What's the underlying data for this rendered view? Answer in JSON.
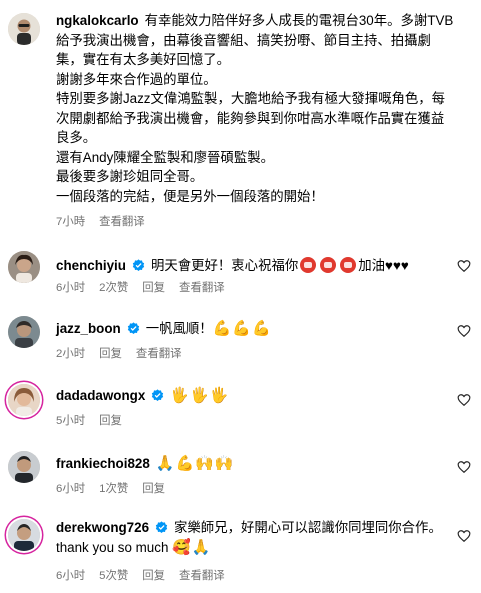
{
  "comments": [
    {
      "username": "ngkalokcarlo",
      "verified": false,
      "text": "有幸能效力陪伴好多人成長的電視台30年。多謝TVB給予我演出機會，由幕後音響組、搞笑扮嘢、節目主持、拍攝劇集，實在有太多美好回憶了。\n謝謝多年來合作過的單位。\n特別要多謝Jazz文偉鴻監製，大膽地給予我有極大發揮嘅角色，每次開劇都給予我演出機會，能夠參與到你咁高水準嘅作品實在獲益良多。\n還有Andy陳耀全監製和廖晉碩監製。\n最後要多謝珍姐同全哥。\n一個段落的完結，便是另外一個段落的開始！",
      "time": "7小時",
      "likes": "",
      "reply": "",
      "translate": "查看翻译",
      "has_heart": false
    },
    {
      "username": "chenchiyiu",
      "verified": true,
      "text_before": "明天會更好！衷心祝福你",
      "text_after": "加油♥♥♥",
      "time": "6小时",
      "likes": "2次赞",
      "reply": "回复",
      "translate": "查看翻译",
      "has_heart": true
    },
    {
      "username": "jazz_boon",
      "verified": true,
      "text": "一帆風順！",
      "time": "2小时",
      "likes": "",
      "reply": "回复",
      "translate": "查看翻译",
      "has_heart": true
    },
    {
      "username": "dadadawongx",
      "verified": true,
      "text": "",
      "time": "5小时",
      "likes": "",
      "reply": "回复",
      "translate": "",
      "has_heart": true
    },
    {
      "username": "frankiechoi828",
      "verified": false,
      "text": "",
      "time": "6小时",
      "likes": "1次赞",
      "reply": "回复",
      "translate": "",
      "has_heart": true
    },
    {
      "username": "derekwong726",
      "verified": true,
      "text": "家樂師兄，好開心可以認識你同埋同你合作。thank you so much",
      "time": "6小时",
      "likes": "5次赞",
      "reply": "回复",
      "translate": "查看翻译",
      "has_heart": true
    }
  ],
  "icons": {
    "verified": "verified-badge-icon",
    "heart": "heart-outline-icon"
  },
  "colors": {
    "verified": "#0095f6",
    "meta": "#737373",
    "story_ring": "#d6249f"
  }
}
